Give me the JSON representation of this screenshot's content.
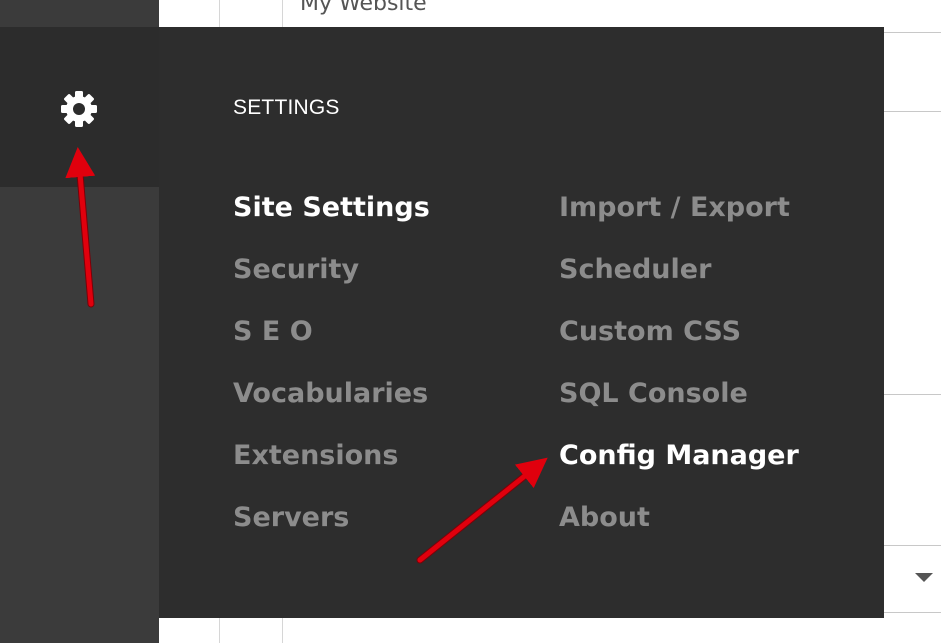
{
  "background": {
    "site_title": "My Website"
  },
  "settings_menu": {
    "title": "SETTINGS",
    "left_items": [
      {
        "label": "Site Settings",
        "active": true
      },
      {
        "label": "Security",
        "active": false
      },
      {
        "label": "S E O",
        "active": false
      },
      {
        "label": "Vocabularies",
        "active": false
      },
      {
        "label": "Extensions",
        "active": false
      },
      {
        "label": "Servers",
        "active": false
      }
    ],
    "right_items": [
      {
        "label": "Import / Export",
        "active": false
      },
      {
        "label": "Scheduler",
        "active": false
      },
      {
        "label": "Custom CSS",
        "active": false
      },
      {
        "label": "SQL Console",
        "active": false
      },
      {
        "label": "Config Manager",
        "active": true
      },
      {
        "label": "About",
        "active": false
      }
    ]
  },
  "sidebar": {
    "active_icon": "gear-icon"
  },
  "colors": {
    "panel_bg": "#2d2d2d",
    "sidebar_bg": "#3b3b3b",
    "item_inactive": "#8c8c8c",
    "item_active": "#ffffff",
    "annotation_arrow": "#e0000d"
  }
}
